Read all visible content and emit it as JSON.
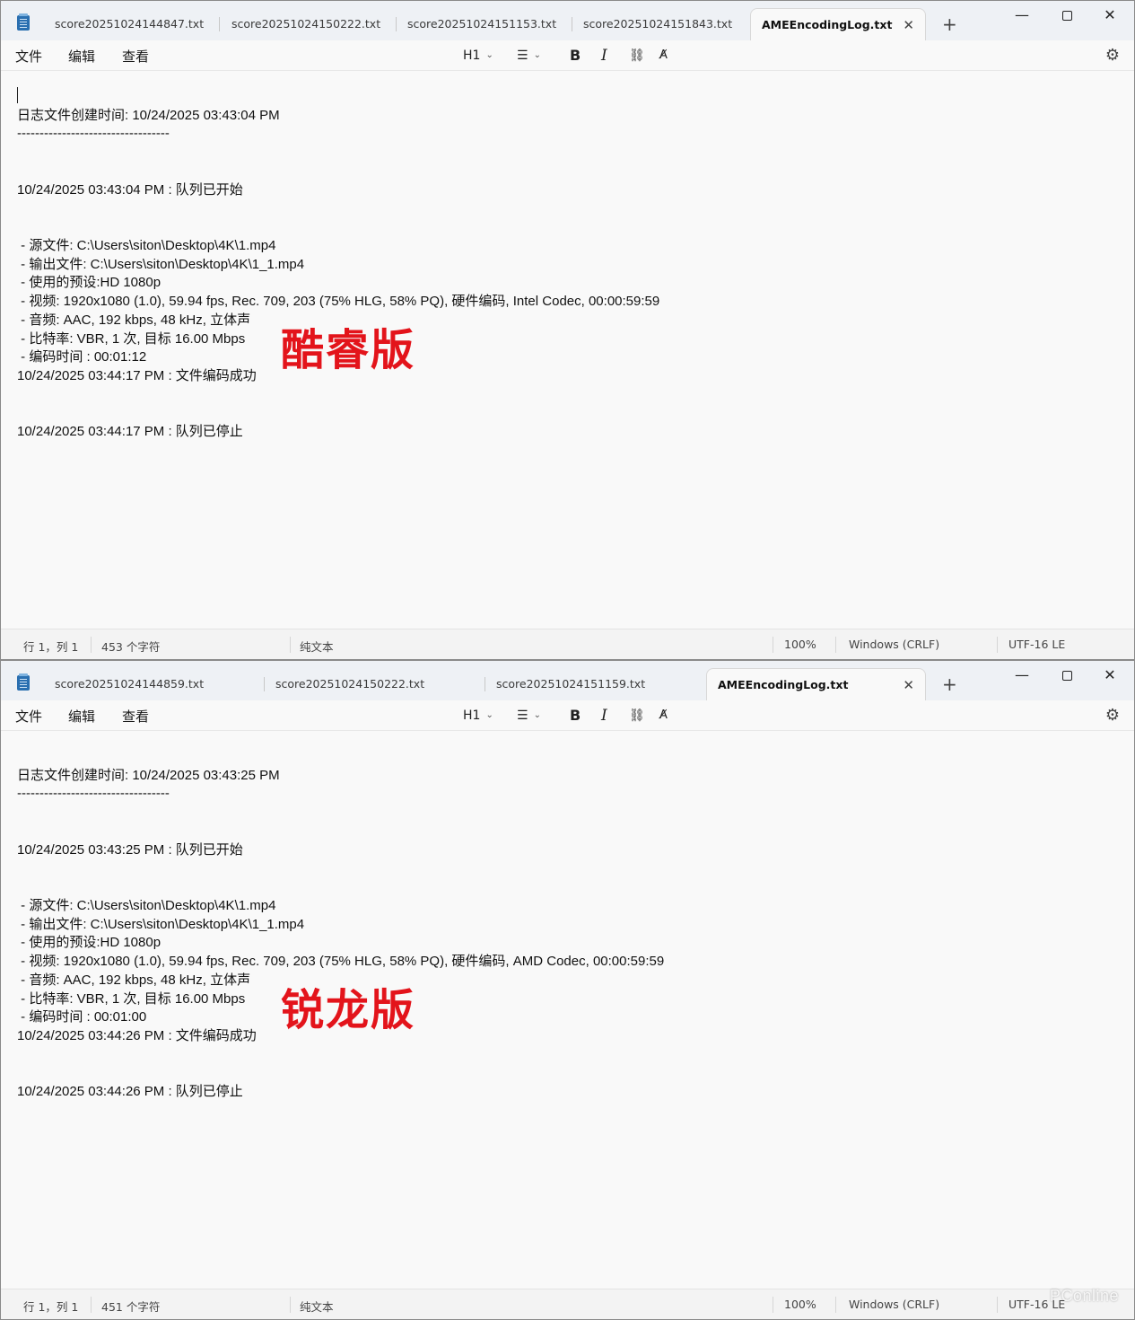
{
  "top_window": {
    "tabs": [
      {
        "label": "score20251024144847.txt"
      },
      {
        "label": "score20251024150222.txt"
      },
      {
        "label": "score20251024151153.txt"
      },
      {
        "label": "score20251024151843.txt"
      },
      {
        "label": "AMEEncodingLog.txt",
        "active": true
      }
    ],
    "menu": [
      "文件",
      "编辑",
      "查看"
    ],
    "toolbar": {
      "heading": "H1"
    },
    "lines": [
      "日志文件创建时间: 10/24/2025 03:43:04 PM",
      "----------------------------------",
      "10/24/2025 03:43:04 PM : 队列已开始",
      " - 源文件: C:\\Users\\siton\\Desktop\\4K\\1.mp4",
      " - 输出文件: C:\\Users\\siton\\Desktop\\4K\\1_1.mp4",
      " - 使用的预设:HD 1080p",
      " - 视频: 1920x1080 (1.0), 59.94 fps, Rec. 709, 203 (75% HLG, 58% PQ), 硬件编码, Intel Codec, 00:00:59:59",
      " - 音频: AAC, 192 kbps, 48 kHz, 立体声",
      " - 比特率: VBR, 1 次, 目标 16.00 Mbps",
      " - 编码时间 : 00:01:12",
      "10/24/2025 03:44:17 PM : 文件编码成功",
      "10/24/2025 03:44:17 PM : 队列已停止"
    ],
    "stamp": "酷睿版",
    "status": {
      "position": "行 1，列 1",
      "chars": "453 个字符",
      "mode": "纯文本",
      "zoom": "100%",
      "line_ending": "Windows (CRLF)",
      "encoding": "UTF-16 LE"
    }
  },
  "bottom_window": {
    "tabs": [
      {
        "label": "score20251024144859.txt"
      },
      {
        "label": "score20251024150222.txt"
      },
      {
        "label": "score20251024151159.txt"
      },
      {
        "label": "AMEEncodingLog.txt",
        "active": true
      }
    ],
    "menu": [
      "文件",
      "编辑",
      "查看"
    ],
    "toolbar": {
      "heading": "H1"
    },
    "lines": [
      "日志文件创建时间: 10/24/2025 03:43:25 PM",
      "----------------------------------",
      "10/24/2025 03:43:25 PM : 队列已开始",
      " - 源文件: C:\\Users\\siton\\Desktop\\4K\\1.mp4",
      " - 输出文件: C:\\Users\\siton\\Desktop\\4K\\1_1.mp4",
      " - 使用的预设:HD 1080p",
      " - 视频: 1920x1080 (1.0), 59.94 fps, Rec. 709, 203 (75% HLG, 58% PQ), 硬件编码, AMD Codec, 00:00:59:59",
      " - 音频: AAC, 192 kbps, 48 kHz, 立体声",
      " - 比特率: VBR, 1 次, 目标 16.00 Mbps",
      " - 编码时间 : 00:01:00",
      "10/24/2025 03:44:26 PM : 文件编码成功",
      "10/24/2025 03:44:26 PM : 队列已停止"
    ],
    "stamp": "锐龙版",
    "status": {
      "position": "行 1，列 1",
      "chars": "451 个字符",
      "mode": "纯文本",
      "zoom": "100%",
      "line_ending": "Windows (CRLF)",
      "encoding": "UTF-16 LE"
    }
  },
  "watermark": "PConline",
  "colors": {
    "stamp": "#e3141b",
    "app_icon": "#2a6fb0"
  }
}
